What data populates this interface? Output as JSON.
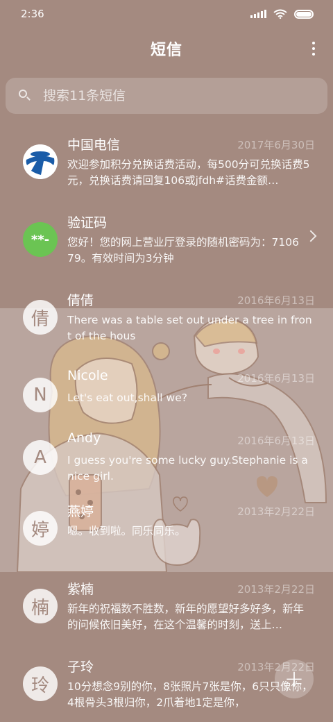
{
  "status_bar": {
    "time": "2:36"
  },
  "header": {
    "title": "短信"
  },
  "search": {
    "placeholder": "搜索11条短信"
  },
  "conversations": [
    {
      "avatar": "",
      "name": "中国电信",
      "date": "2017年6月30日",
      "snippet": "欢迎参加积分兑换话费活动，每500分可兑换话费5元，兑换话费请回复106或jfdh#话费金额…"
    },
    {
      "avatar": "**-",
      "name": "验证码",
      "date": "",
      "snippet": "您好！您的网上营业厅登录的随机密码为：710679。有效时间为3分钟"
    },
    {
      "avatar": "倩",
      "name": "倩倩",
      "date": "2016年6月13日",
      "snippet": "There was a table set out under a tree in front of the hous"
    },
    {
      "avatar": "N",
      "name": "Nicole",
      "date": "2016年6月13日",
      "snippet": "Let's eat out,shall we?"
    },
    {
      "avatar": "A",
      "name": "Andy",
      "date": "2016年6月13日",
      "snippet": "I guess you're some lucky guy.Stephanie is a nice girl."
    },
    {
      "avatar": "婷",
      "name": "燕婷",
      "date": "2013年2月22日",
      "snippet": "嗯。收到啦。同乐同乐。"
    },
    {
      "avatar": "楠",
      "name": "紫楠",
      "date": "2013年2月22日",
      "snippet": "新年的祝福数不胜数，新年的愿望好多好多，新年的问候依旧美好，在这个温馨的时刻，送上…"
    },
    {
      "avatar": "玲",
      "name": "子玲",
      "date": "2013年2月22日",
      "snippet": "10分想念9别的你，8张照片7张是你，6只只像你，4根骨头3根归你，2爪着地1定是你，"
    }
  ],
  "fab": {
    "label": "+"
  }
}
